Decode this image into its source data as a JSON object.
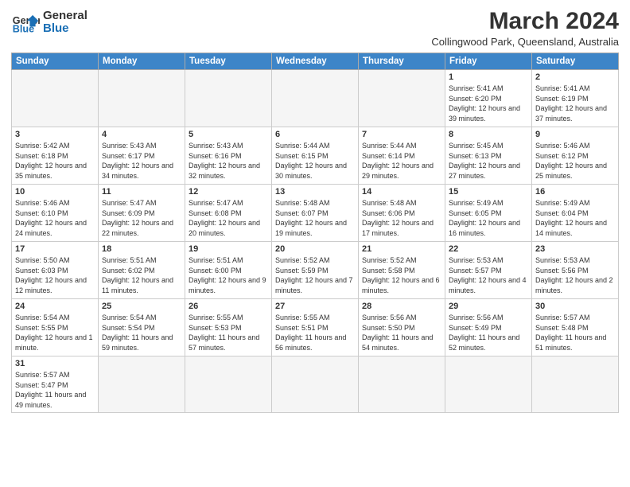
{
  "header": {
    "logo_general": "General",
    "logo_blue": "Blue",
    "main_title": "March 2024",
    "subtitle": "Collingwood Park, Queensland, Australia"
  },
  "weekdays": [
    "Sunday",
    "Monday",
    "Tuesday",
    "Wednesday",
    "Thursday",
    "Friday",
    "Saturday"
  ],
  "weeks": [
    [
      {
        "day": "",
        "info": "",
        "empty": true
      },
      {
        "day": "",
        "info": "",
        "empty": true
      },
      {
        "day": "",
        "info": "",
        "empty": true
      },
      {
        "day": "",
        "info": "",
        "empty": true
      },
      {
        "day": "",
        "info": "",
        "empty": true
      },
      {
        "day": "1",
        "info": "Sunrise: 5:41 AM\nSunset: 6:20 PM\nDaylight: 12 hours\nand 39 minutes."
      },
      {
        "day": "2",
        "info": "Sunrise: 5:41 AM\nSunset: 6:19 PM\nDaylight: 12 hours\nand 37 minutes."
      }
    ],
    [
      {
        "day": "3",
        "info": "Sunrise: 5:42 AM\nSunset: 6:18 PM\nDaylight: 12 hours\nand 35 minutes."
      },
      {
        "day": "4",
        "info": "Sunrise: 5:43 AM\nSunset: 6:17 PM\nDaylight: 12 hours\nand 34 minutes."
      },
      {
        "day": "5",
        "info": "Sunrise: 5:43 AM\nSunset: 6:16 PM\nDaylight: 12 hours\nand 32 minutes."
      },
      {
        "day": "6",
        "info": "Sunrise: 5:44 AM\nSunset: 6:15 PM\nDaylight: 12 hours\nand 30 minutes."
      },
      {
        "day": "7",
        "info": "Sunrise: 5:44 AM\nSunset: 6:14 PM\nDaylight: 12 hours\nand 29 minutes."
      },
      {
        "day": "8",
        "info": "Sunrise: 5:45 AM\nSunset: 6:13 PM\nDaylight: 12 hours\nand 27 minutes."
      },
      {
        "day": "9",
        "info": "Sunrise: 5:46 AM\nSunset: 6:12 PM\nDaylight: 12 hours\nand 25 minutes."
      }
    ],
    [
      {
        "day": "10",
        "info": "Sunrise: 5:46 AM\nSunset: 6:10 PM\nDaylight: 12 hours\nand 24 minutes."
      },
      {
        "day": "11",
        "info": "Sunrise: 5:47 AM\nSunset: 6:09 PM\nDaylight: 12 hours\nand 22 minutes."
      },
      {
        "day": "12",
        "info": "Sunrise: 5:47 AM\nSunset: 6:08 PM\nDaylight: 12 hours\nand 20 minutes."
      },
      {
        "day": "13",
        "info": "Sunrise: 5:48 AM\nSunset: 6:07 PM\nDaylight: 12 hours\nand 19 minutes."
      },
      {
        "day": "14",
        "info": "Sunrise: 5:48 AM\nSunset: 6:06 PM\nDaylight: 12 hours\nand 17 minutes."
      },
      {
        "day": "15",
        "info": "Sunrise: 5:49 AM\nSunset: 6:05 PM\nDaylight: 12 hours\nand 16 minutes."
      },
      {
        "day": "16",
        "info": "Sunrise: 5:49 AM\nSunset: 6:04 PM\nDaylight: 12 hours\nand 14 minutes."
      }
    ],
    [
      {
        "day": "17",
        "info": "Sunrise: 5:50 AM\nSunset: 6:03 PM\nDaylight: 12 hours\nand 12 minutes."
      },
      {
        "day": "18",
        "info": "Sunrise: 5:51 AM\nSunset: 6:02 PM\nDaylight: 12 hours\nand 11 minutes."
      },
      {
        "day": "19",
        "info": "Sunrise: 5:51 AM\nSunset: 6:00 PM\nDaylight: 12 hours\nand 9 minutes."
      },
      {
        "day": "20",
        "info": "Sunrise: 5:52 AM\nSunset: 5:59 PM\nDaylight: 12 hours\nand 7 minutes."
      },
      {
        "day": "21",
        "info": "Sunrise: 5:52 AM\nSunset: 5:58 PM\nDaylight: 12 hours\nand 6 minutes."
      },
      {
        "day": "22",
        "info": "Sunrise: 5:53 AM\nSunset: 5:57 PM\nDaylight: 12 hours\nand 4 minutes."
      },
      {
        "day": "23",
        "info": "Sunrise: 5:53 AM\nSunset: 5:56 PM\nDaylight: 12 hours\nand 2 minutes."
      }
    ],
    [
      {
        "day": "24",
        "info": "Sunrise: 5:54 AM\nSunset: 5:55 PM\nDaylight: 12 hours\nand 1 minute."
      },
      {
        "day": "25",
        "info": "Sunrise: 5:54 AM\nSunset: 5:54 PM\nDaylight: 11 hours\nand 59 minutes."
      },
      {
        "day": "26",
        "info": "Sunrise: 5:55 AM\nSunset: 5:53 PM\nDaylight: 11 hours\nand 57 minutes."
      },
      {
        "day": "27",
        "info": "Sunrise: 5:55 AM\nSunset: 5:51 PM\nDaylight: 11 hours\nand 56 minutes."
      },
      {
        "day": "28",
        "info": "Sunrise: 5:56 AM\nSunset: 5:50 PM\nDaylight: 11 hours\nand 54 minutes."
      },
      {
        "day": "29",
        "info": "Sunrise: 5:56 AM\nSunset: 5:49 PM\nDaylight: 11 hours\nand 52 minutes."
      },
      {
        "day": "30",
        "info": "Sunrise: 5:57 AM\nSunset: 5:48 PM\nDaylight: 11 hours\nand 51 minutes."
      }
    ],
    [
      {
        "day": "31",
        "info": "Sunrise: 5:57 AM\nSunset: 5:47 PM\nDaylight: 11 hours\nand 49 minutes.",
        "last": true
      },
      {
        "day": "",
        "info": "",
        "empty": true,
        "last": true
      },
      {
        "day": "",
        "info": "",
        "empty": true,
        "last": true
      },
      {
        "day": "",
        "info": "",
        "empty": true,
        "last": true
      },
      {
        "day": "",
        "info": "",
        "empty": true,
        "last": true
      },
      {
        "day": "",
        "info": "",
        "empty": true,
        "last": true
      },
      {
        "day": "",
        "info": "",
        "empty": true,
        "last": true
      }
    ]
  ]
}
